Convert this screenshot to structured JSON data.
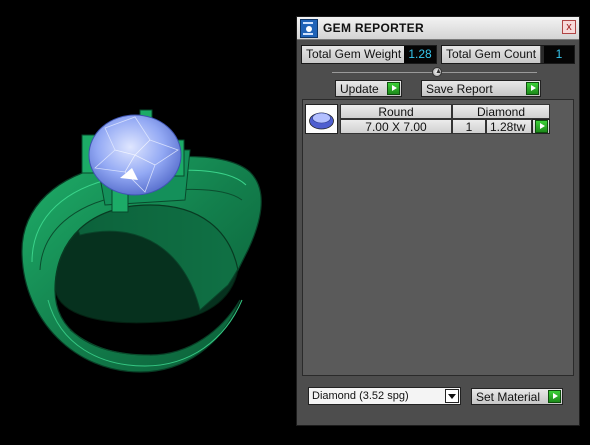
{
  "panel": {
    "title": "GEM REPORTER",
    "close_glyph": "x",
    "icon": "gem-reporter-app-icon"
  },
  "totals": {
    "weight_label": "Total Gem Weight",
    "weight_value": "1.28",
    "count_label": "Total Gem Count",
    "count_value": "1"
  },
  "buttons": {
    "update_label": "Update",
    "save_report_label": "Save Report",
    "set_material_label": "Set Material"
  },
  "gem_table": {
    "headers": {
      "shape": "Round",
      "material": "Diamond"
    },
    "rows": [
      {
        "size": "7.00 X 7.00",
        "count": "1",
        "weight": "1.28tw",
        "thumb_icon": "round-gem-icon"
      }
    ]
  },
  "material_select": {
    "selected": "Diamond    (3.52 spg)"
  },
  "viewport": {
    "subject": "ring-3d-model",
    "band_color": "#1a8f5c",
    "stone_color": "#8fa8f7"
  }
}
